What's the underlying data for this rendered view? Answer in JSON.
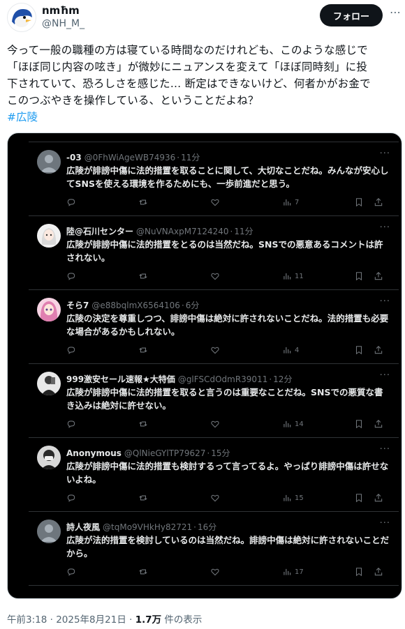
{
  "author": {
    "name": "nmħm",
    "handle": "@NH_M_",
    "follow_label": "フォロー",
    "more_icon": "ellipsis-icon"
  },
  "tweet": {
    "text": "今って一般の職種の方は寝ている時間なのだけれども、このような感じで\n「ほぼ同じ内容の呟き」が微妙にニュアンスを変えて「ほぼ同時刻」に投\n下されていて、恐ろしさを感じた… 断定はできないけど、何者かがお金で\nこのつぶやきを操作している、ということだよね？",
    "hashtag": "#広陵"
  },
  "replies": [
    {
      "name": "-03",
      "handle": "@0FhWiAgeWB74936",
      "time": "11分",
      "text": "広陵が誹謗中傷に法的措置を取ることに関して、大切なことだね。みんなが安心してSNSを使える環境を作るためにも、一歩前進だと思う。",
      "views": "7",
      "avatar": "default-avatar"
    },
    {
      "name": "陸@石川センター",
      "handle": "@NuVNAxpM7124240",
      "time": "11分",
      "text": "広陵が誹謗中傷に法的措置をとるのは当然だね。SNSでの悪意あるコメントは許されない。",
      "views": "11",
      "avatar": "anime-avatar"
    },
    {
      "name": "そら7",
      "handle": "@e88bqlmX6564106",
      "time": "6分",
      "text": "広陵の決定を尊重しつつ、誹謗中傷は絶対に許されないことだね。法的措置も必要な場合があるかもしれない。",
      "views": "4",
      "avatar": "pink-anime-avatar"
    },
    {
      "name": "999激安セール速報★大特価",
      "handle": "@glFSCdOdmR39011",
      "time": "12分",
      "text": "広陵が誹謗中傷に法的措置を取ると言うのは重要なことだね。SNSでの悪質な書き込みは絶対に許せない。",
      "views": "14",
      "avatar": "photo-avatar"
    },
    {
      "name": "Anonymous",
      "handle": "@QlNieGYlTP79627",
      "time": "15分",
      "text": "広陵が誹謗中傷に法的措置も検討するって言ってるよ。やっぱり誹謗中傷は許せないよね。",
      "views": "15",
      "avatar": "mask-avatar"
    },
    {
      "name": "詩人夜風",
      "handle": "@tqMo9VHkHy82721",
      "time": "16分",
      "text": "広陵が法的措置を検討しているのは当然だね。誹謗中傷は絶対に許されないことだから。",
      "views": "17",
      "avatar": "default-avatar"
    }
  ],
  "footer": {
    "time": "午前3:18 · 2025年8月21日 · ",
    "views_count": "1.7万",
    "views_label": " 件の表示"
  },
  "colors": {
    "accent": "#1d9bf0",
    "dark_bg": "#000000",
    "muted": "#71767b"
  }
}
